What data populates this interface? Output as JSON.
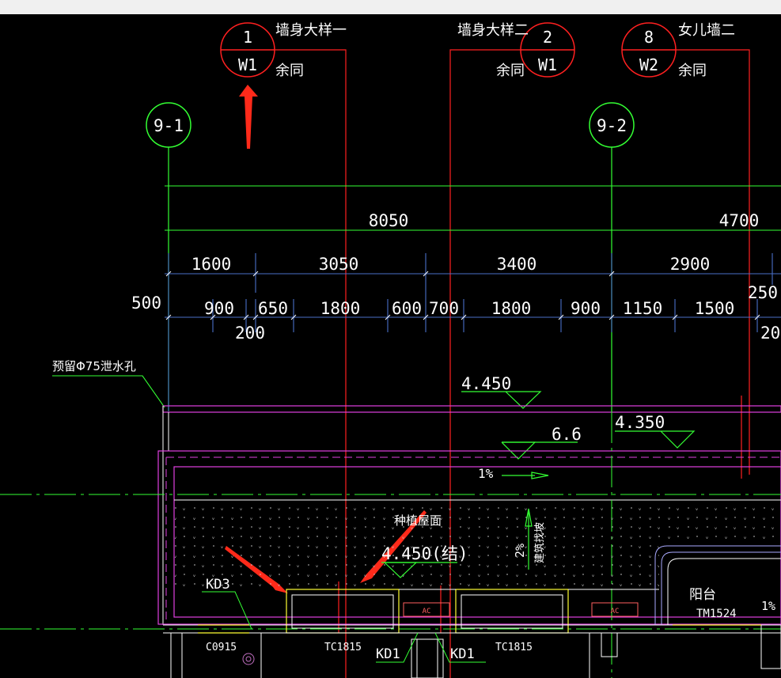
{
  "detail_callouts": [
    {
      "number": "1",
      "sheet": "W1",
      "title": "墙身大样一",
      "note": "余同"
    },
    {
      "number": "2",
      "sheet": "W1",
      "title": "墙身大样二",
      "note": "余同"
    },
    {
      "number": "8",
      "sheet": "W2",
      "title": "女儿墙二",
      "note": "余同"
    }
  ],
  "axis_labels": [
    "9-1",
    "9-2"
  ],
  "dimensions": {
    "overall": [
      "8050",
      "4700"
    ],
    "middle": [
      "1600",
      "3050",
      "3400",
      "2900"
    ],
    "detail": [
      "900",
      "650",
      "1800",
      "600",
      "700",
      "1800",
      "900",
      "1150",
      "1500",
      "250"
    ],
    "extra": [
      "500",
      "200",
      "20"
    ]
  },
  "elevations": [
    "4.450",
    "6.6",
    "4.350",
    "4.450(结)"
  ],
  "notes": {
    "drain_hole": "预留Φ75泄水孔",
    "roof": "种植屋面",
    "slope_pct": "1%",
    "slope_pct_right": "1%",
    "slope_vertical": "2%",
    "slope_vertical_note": "建筑找坡",
    "balcony": "阳台"
  },
  "components": {
    "kd3": "KD3",
    "kd1_left": "KD1",
    "kd1_right": "KD1",
    "window_left": "C0915",
    "window_tc1": "TC1815",
    "window_tc2": "TC1815",
    "door_tm": "TM1524",
    "ac_label": "AC"
  },
  "colors": {
    "background": "#000000",
    "axis_green": "#33ff33",
    "dim_blue": "#4a6fc8",
    "callout_red": "#ff2020",
    "wall_magenta": "#e040e0",
    "yellow": "#ffff33",
    "arrow_red": "#ff2a1a"
  }
}
